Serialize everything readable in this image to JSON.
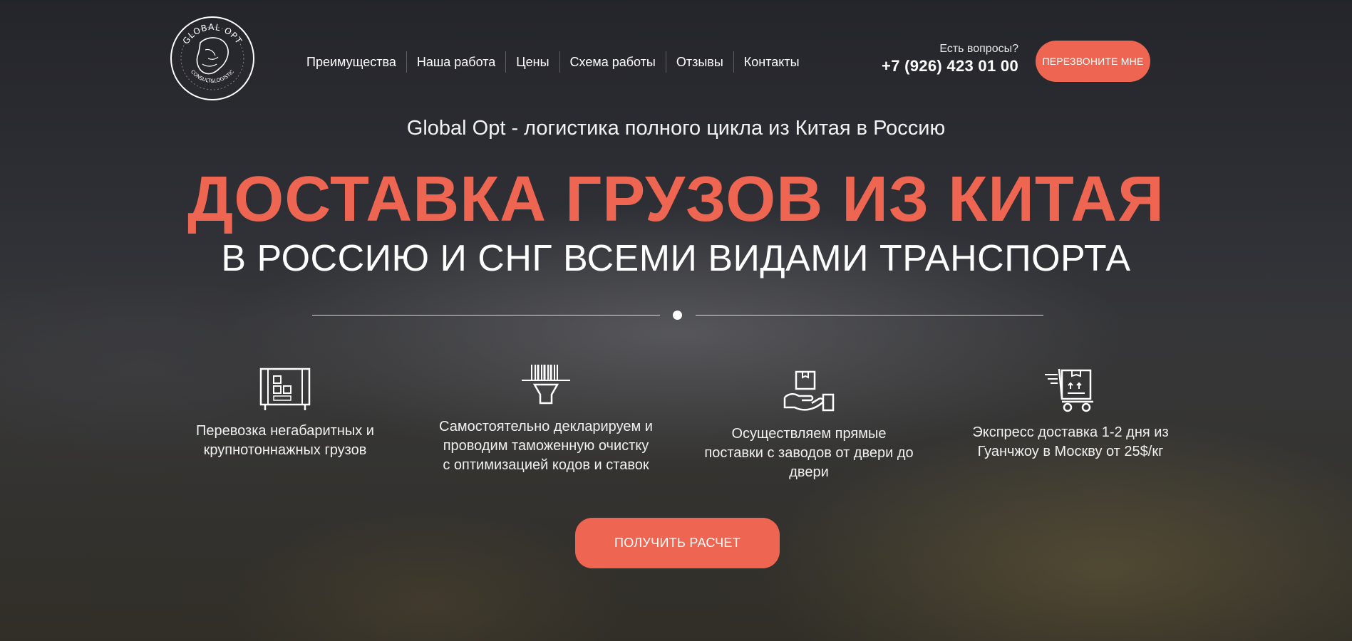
{
  "brand": {
    "logo_top_text": "GLOBAL OPT",
    "logo_bottom_text": "CONSULT&LOGISTIC"
  },
  "nav": {
    "items": [
      "Преимущества",
      "Наша работа",
      "Цены",
      "Схема работы",
      "Отзывы",
      "Контакты"
    ]
  },
  "contact": {
    "question": "Есть вопросы?",
    "phone": "+7 (926) 423 01 00",
    "callback_label": "ПЕРЕЗВОНИТЕ МНЕ"
  },
  "hero": {
    "tagline": "Global Opt - логистика полного цикла из Китая в Россию",
    "title": "ДОСТАВКА ГРУЗОВ ИЗ КИТАЯ",
    "subtitle": "В РОССИЮ И СНГ ВСЕМИ ВИДАМИ ТРАНСПОРТА"
  },
  "features": [
    {
      "icon": "container-icon",
      "text": "Перевозка негабаритных и крупнотоннажных грузов"
    },
    {
      "icon": "barcode-scanner-icon",
      "text": "Самостоятельно декларируем и проводим таможенную очистку с оптимизацией кодов и ставок"
    },
    {
      "icon": "hand-box-icon",
      "text": "Осуществляем прямые поставки с заводов от двери до двери"
    },
    {
      "icon": "delivery-cart-icon",
      "text": "Экспресс доставка 1-2 дня из Гуанчжоу в Москву от 25$/кг"
    }
  ],
  "cta": {
    "label": "ПОЛУЧИТЬ РАСЧЕТ"
  },
  "colors": {
    "accent": "#ee6651",
    "text": "#ffffff"
  }
}
